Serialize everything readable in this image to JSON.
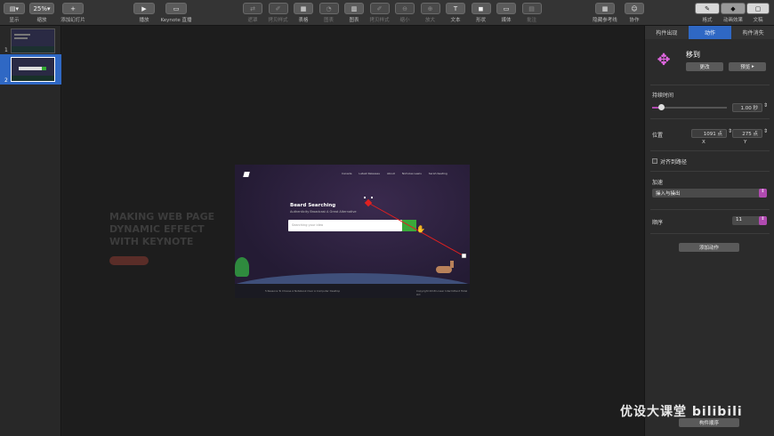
{
  "toolbar": {
    "view_label": "显示",
    "zoom_value": "25%",
    "zoom_label": "缩放",
    "add_slide_label": "添加幻灯片",
    "play_label": "播放",
    "keynote_live_label": "Keynote 直播",
    "tools": [
      {
        "label": "遮罩",
        "dim": true
      },
      {
        "label": "拷贝样式",
        "dim": true
      },
      {
        "label": "表格",
        "dim": false
      },
      {
        "label": "图表",
        "dim": true
      },
      {
        "label": "图表",
        "dim": false
      },
      {
        "label": "拷贝样式",
        "dim": true
      },
      {
        "label": "缩小",
        "dim": true
      },
      {
        "label": "放大",
        "dim": true
      },
      {
        "label": "文本",
        "dim": false
      },
      {
        "label": "形状",
        "dim": false
      },
      {
        "label": "媒体",
        "dim": false
      },
      {
        "label": "批注",
        "dim": true
      }
    ],
    "hide_guides_label": "隐藏参考线",
    "collab_label": "协作",
    "format_label": "格式",
    "animate_label": "动画效果",
    "document_label": "文稿"
  },
  "sidebar": {
    "slides": [
      {
        "number": "1"
      },
      {
        "number": "2"
      }
    ]
  },
  "canvas": {
    "ghost_title": "MAKING WEB PAGE DYNAMIC EFFECT WITH KEYNOTE",
    "slide": {
      "nav": [
        "Canada",
        "Latest Releases",
        "About",
        "Nicholas Lewis",
        "Sarah Keating"
      ],
      "heading": "Beard Searching",
      "subheading": "Authenticity Broadcast A Great Alternative",
      "search_placeholder": "Searching your idea",
      "footer_left": "5 Reasons To Choose A Notebook Over A Computer Desktop",
      "footer_right": "Copyright 2018 Linear Intermittent Hotel Ltd"
    }
  },
  "panel": {
    "tabs": [
      "构件出现",
      "动作",
      "构件消失"
    ],
    "action_name": "移到",
    "change_label": "更改",
    "preview_label": "预览",
    "duration_label": "持续时间",
    "duration_value": "1.00 秒",
    "duration_fraction": 0.12,
    "position_label": "位置",
    "pos_x": "1091 点",
    "pos_y": "275 点",
    "x_label": "X",
    "y_label": "Y",
    "align_path_label": "对齐到路径",
    "accel_label": "加速",
    "accel_value": "操入与操出",
    "order_label": "顺序",
    "order_value": "11",
    "add_action_label": "添加动作",
    "build_order_label": "构件顺序"
  },
  "watermark": "优设大课堂 bilibili",
  "colors": {
    "accent": "#2f68c4",
    "path_red": "#e02020",
    "selection": "#ffffff",
    "animation_icon": "#e066e0",
    "slider_track": "#b04ab0"
  }
}
